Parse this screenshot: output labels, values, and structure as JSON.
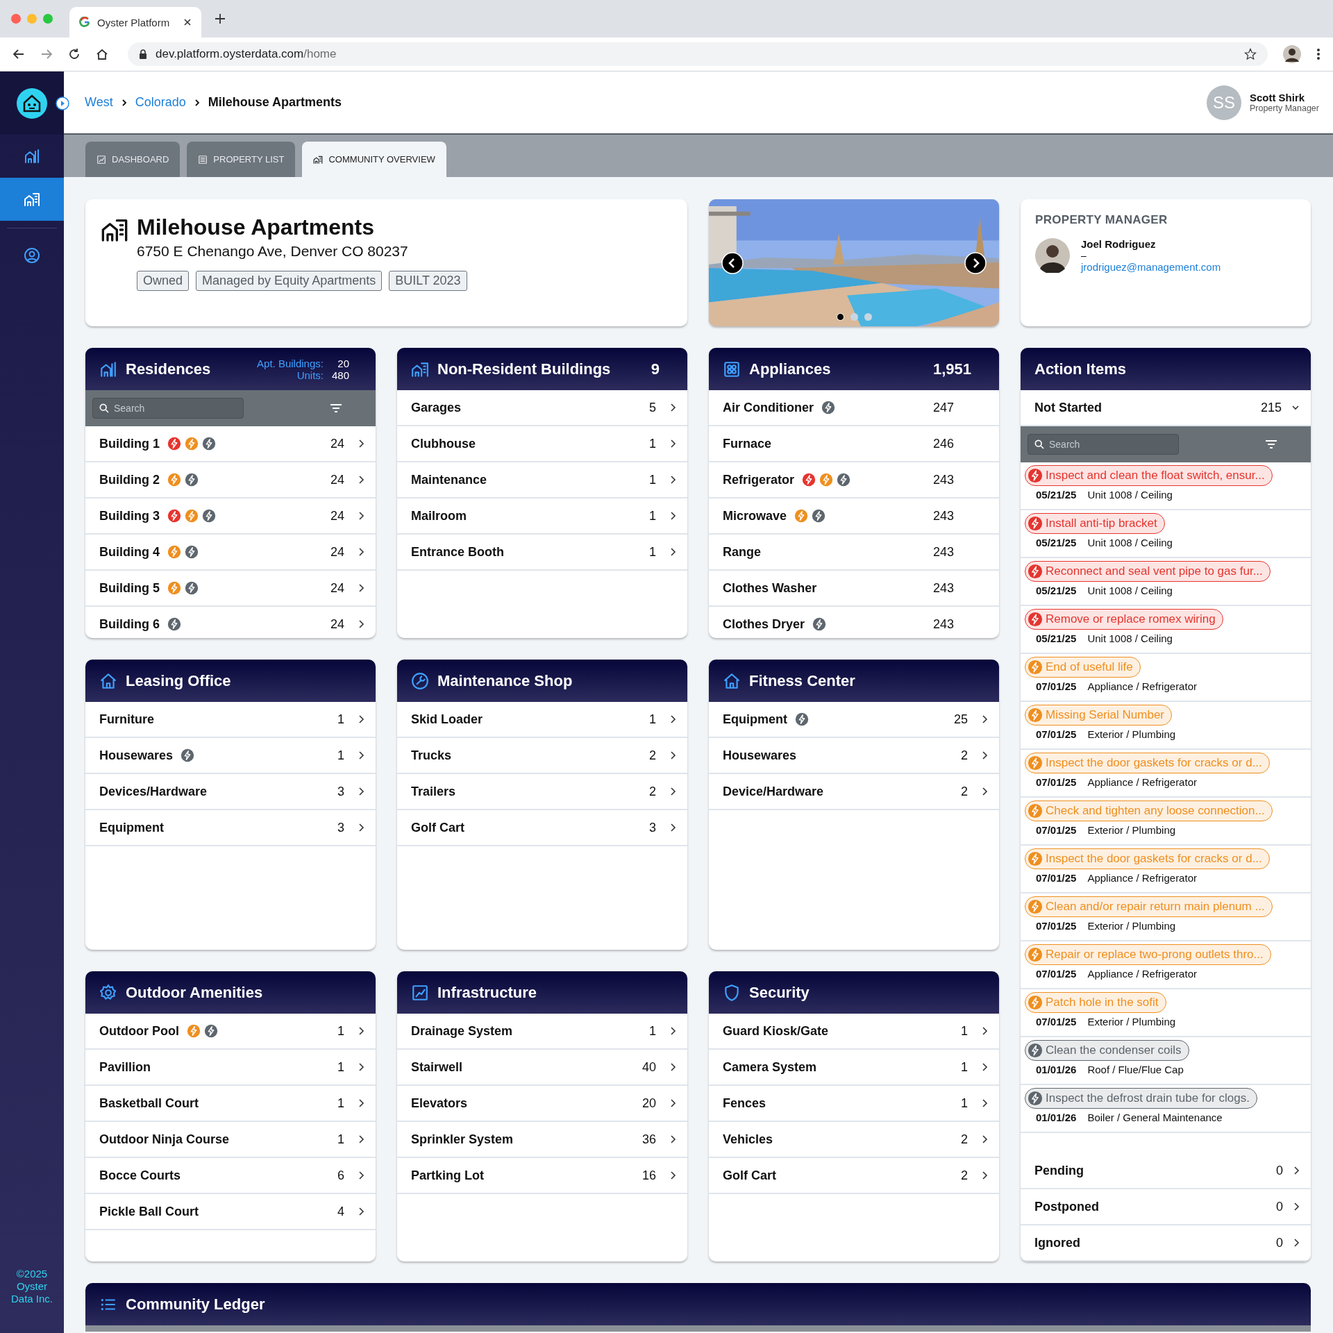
{
  "browser": {
    "tab_title": "Oyster Platform",
    "url_host": "dev.platform.oysterdata.com",
    "url_path": "/home"
  },
  "sidebar": {
    "items": [
      {
        "kind": "buildings",
        "selected": false
      },
      {
        "kind": "community",
        "selected": true
      },
      {
        "kind": "account",
        "selected": false
      }
    ],
    "footer": "©2025 Oyster Data Inc."
  },
  "breadcrumb": [
    {
      "label": "West",
      "kind": "link"
    },
    {
      "label": "Colorado",
      "kind": "link"
    },
    {
      "label": "Milehouse Apartments",
      "kind": "current"
    }
  ],
  "user": {
    "initials": "SS",
    "name": "Scott Shirk",
    "role": "Property Manager"
  },
  "tabs": [
    {
      "label": "DASHBOARD",
      "kind": "chart",
      "selected": false
    },
    {
      "label": "PROPERTY LIST",
      "kind": "list",
      "selected": false
    },
    {
      "label": "COMMUNITY OVERVIEW",
      "kind": "community",
      "selected": true
    }
  ],
  "property": {
    "name": "Milehouse Apartments",
    "address": "6750 E Chenango Ave, Denver CO 80237",
    "tags": [
      "Owned",
      "Managed by Equity Apartments",
      "BUILT 2023"
    ]
  },
  "carousel": {
    "dots": [
      {
        "selected": true
      },
      {
        "selected": false
      },
      {
        "selected": false
      }
    ]
  },
  "manager": {
    "heading": "PROPERTY MANAGER",
    "name": "Joel Rodriguez",
    "separator": "–",
    "email": "jrodriguez@management.com"
  },
  "cards": [
    {
      "title": "Residences",
      "kind": "buildings",
      "stats": [
        {
          "label": "Apt. Buildings:",
          "value": "20"
        },
        {
          "label": "Units:",
          "value": "480"
        }
      ],
      "search": {
        "placeholder": "Search"
      },
      "chevrons": true,
      "items": [
        {
          "label": "Building 1",
          "alerts": [
            {
              "color": "#e5352f"
            },
            {
              "color": "#ef8f1f"
            },
            {
              "color": "#5e666e"
            }
          ],
          "count": "24"
        },
        {
          "label": "Building 2",
          "alerts": [
            {
              "color": "#ef8f1f"
            },
            {
              "color": "#5e666e"
            }
          ],
          "count": "24"
        },
        {
          "label": "Building 3",
          "alerts": [
            {
              "color": "#e5352f"
            },
            {
              "color": "#ef8f1f"
            },
            {
              "color": "#5e666e"
            }
          ],
          "count": "24"
        },
        {
          "label": "Building 4",
          "alerts": [
            {
              "color": "#ef8f1f"
            },
            {
              "color": "#5e666e"
            }
          ],
          "count": "24"
        },
        {
          "label": "Building 5",
          "alerts": [
            {
              "color": "#ef8f1f"
            },
            {
              "color": "#5e666e"
            }
          ],
          "count": "24"
        },
        {
          "label": "Building 6",
          "alerts": [
            {
              "color": "#5e666e"
            }
          ],
          "count": "24"
        }
      ]
    },
    {
      "title": "Non-Resident Buildings",
      "kind": "community",
      "count": "9",
      "chevrons": true,
      "items": [
        {
          "label": "Garages",
          "count": "5"
        },
        {
          "label": "Clubhouse",
          "count": "1"
        },
        {
          "label": "Maintenance",
          "count": "1"
        },
        {
          "label": "Mailroom",
          "count": "1"
        },
        {
          "label": "Entrance Booth",
          "count": "1"
        }
      ]
    },
    {
      "title": "Appliances",
      "kind": "stove",
      "count": "1,951",
      "chevrons": false,
      "items": [
        {
          "label": "Air Conditioner",
          "alerts": [
            {
              "color": "#5e666e"
            }
          ],
          "count": "247"
        },
        {
          "label": "Furnace",
          "count": "246"
        },
        {
          "label": "Refrigerator",
          "alerts": [
            {
              "color": "#e5352f"
            },
            {
              "color": "#ef8f1f"
            },
            {
              "color": "#5e666e"
            }
          ],
          "count": "243"
        },
        {
          "label": "Microwave",
          "alerts": [
            {
              "color": "#ef8f1f"
            },
            {
              "color": "#5e666e"
            }
          ],
          "count": "243"
        },
        {
          "label": "Range",
          "count": "243"
        },
        {
          "label": "Clothes Washer",
          "count": "243"
        },
        {
          "label": "Clothes Dryer",
          "alerts": [
            {
              "color": "#5e666e"
            }
          ],
          "count": "243"
        }
      ]
    },
    {
      "title": "Leasing Office",
      "kind": "house",
      "chevrons": true,
      "items": [
        {
          "label": "Furniture",
          "count": "1"
        },
        {
          "label": "Housewares",
          "alerts": [
            {
              "color": "#5e666e"
            }
          ],
          "count": "1"
        },
        {
          "label": "Devices/Hardware",
          "count": "3"
        },
        {
          "label": "Equipment",
          "count": "3"
        }
      ]
    },
    {
      "title": "Maintenance Shop",
      "kind": "wrench",
      "chevrons": true,
      "items": [
        {
          "label": "Skid Loader",
          "count": "1"
        },
        {
          "label": "Trucks",
          "count": "2"
        },
        {
          "label": "Trailers",
          "count": "2"
        },
        {
          "label": "Golf Cart",
          "count": "3"
        }
      ]
    },
    {
      "title": "Fitness Center",
      "kind": "house",
      "chevrons": true,
      "items": [
        {
          "label": "Equipment",
          "alerts": [
            {
              "color": "#5e666e"
            }
          ],
          "count": "25"
        },
        {
          "label": "Housewares",
          "count": "2"
        },
        {
          "label": "Device/Hardware",
          "count": "2"
        }
      ]
    },
    {
      "title": "Outdoor Amenities",
      "kind": "gear",
      "chevrons": true,
      "items": [
        {
          "label": "Outdoor Pool",
          "alerts": [
            {
              "color": "#ef8f1f"
            },
            {
              "color": "#5e666e"
            }
          ],
          "count": "1"
        },
        {
          "label": "Pavillion",
          "count": "1"
        },
        {
          "label": "Basketball Court",
          "count": "1"
        },
        {
          "label": "Outdoor Ninja Course",
          "count": "1"
        },
        {
          "label": "Bocce Courts",
          "count": "6"
        },
        {
          "label": "Pickle Ball Court",
          "count": "4"
        }
      ]
    },
    {
      "title": "Infrastructure",
      "kind": "chart",
      "chevrons": true,
      "items": [
        {
          "label": "Drainage System",
          "count": "1"
        },
        {
          "label": "Stairwell",
          "count": "40"
        },
        {
          "label": "Elevators",
          "count": "20"
        },
        {
          "label": "Sprinkler System",
          "count": "36"
        },
        {
          "label": "Partking Lot",
          "count": "16"
        }
      ]
    },
    {
      "title": "Security",
      "kind": "shield",
      "chevrons": true,
      "items": [
        {
          "label": "Guard Kiosk/Gate",
          "count": "1"
        },
        {
          "label": "Camera System",
          "count": "1"
        },
        {
          "label": "Fences",
          "count": "1"
        },
        {
          "label": "Vehicles",
          "count": "2"
        },
        {
          "label": "Golf Cart",
          "count": "2"
        }
      ]
    }
  ],
  "action_items": {
    "title": "Action Items",
    "groups": [
      {
        "label": "Not Started",
        "count": "215",
        "expanded": true,
        "search": {
          "placeholder": "Search"
        },
        "items": [
          {
            "color": "#e5352f",
            "title": "Inspect and clean the float switch, ensur...",
            "date": "05/21/25",
            "location": "Unit 1008 / Ceiling"
          },
          {
            "color": "#e5352f",
            "title": "Install anti-tip bracket",
            "date": "05/21/25",
            "location": "Unit 1008 / Ceiling"
          },
          {
            "color": "#e5352f",
            "title": "Reconnect and seal vent pipe to gas fur...",
            "date": "05/21/25",
            "location": "Unit 1008 / Ceiling"
          },
          {
            "color": "#e5352f",
            "title": "Remove or replace romex wiring",
            "date": "05/21/25",
            "location": "Unit 1008 / Ceiling"
          },
          {
            "color": "#ef8f1f",
            "title": "End of useful life",
            "date": "07/01/25",
            "location": "Appliance / Refrigerator"
          },
          {
            "color": "#ef8f1f",
            "title": "Missing Serial Number",
            "date": "07/01/25",
            "location": "Exterior / Plumbing"
          },
          {
            "color": "#ef8f1f",
            "title": "Inspect the door gaskets for cracks or d...",
            "date": "07/01/25",
            "location": "Appliance / Refrigerator"
          },
          {
            "color": "#ef8f1f",
            "title": "Check and tighten any loose connection...",
            "date": "07/01/25",
            "location": "Exterior / Plumbing"
          },
          {
            "color": "#ef8f1f",
            "title": "Inspect the door gaskets for cracks or d...",
            "date": "07/01/25",
            "location": "Appliance / Refrigerator"
          },
          {
            "color": "#ef8f1f",
            "title": "Clean and/or repair return main plenum ...",
            "date": "07/01/25",
            "location": "Exterior / Plumbing"
          },
          {
            "color": "#ef8f1f",
            "title": "Repair or replace two-prong outlets thro...",
            "date": "07/01/25",
            "location": "Appliance / Refrigerator"
          },
          {
            "color": "#ef8f1f",
            "title": "Patch hole in the sofit",
            "date": "07/01/25",
            "location": "Exterior / Plumbing"
          },
          {
            "color": "#5e666e",
            "title": "Clean the condenser coils",
            "date": "01/01/26",
            "location": "Roof / Flue/Flue Cap"
          },
          {
            "color": "#5e666e",
            "title": "Inspect the defrost drain tube for clogs.",
            "date": "01/01/26",
            "location": "Boiler / General Maintenance"
          }
        ]
      },
      {
        "label": "Pending",
        "count": "0",
        "expanded": false
      },
      {
        "label": "Postponed",
        "count": "0",
        "expanded": false
      },
      {
        "label": "Ignored",
        "count": "0",
        "expanded": false
      }
    ]
  },
  "ledger": {
    "title": "Community Ledger"
  }
}
